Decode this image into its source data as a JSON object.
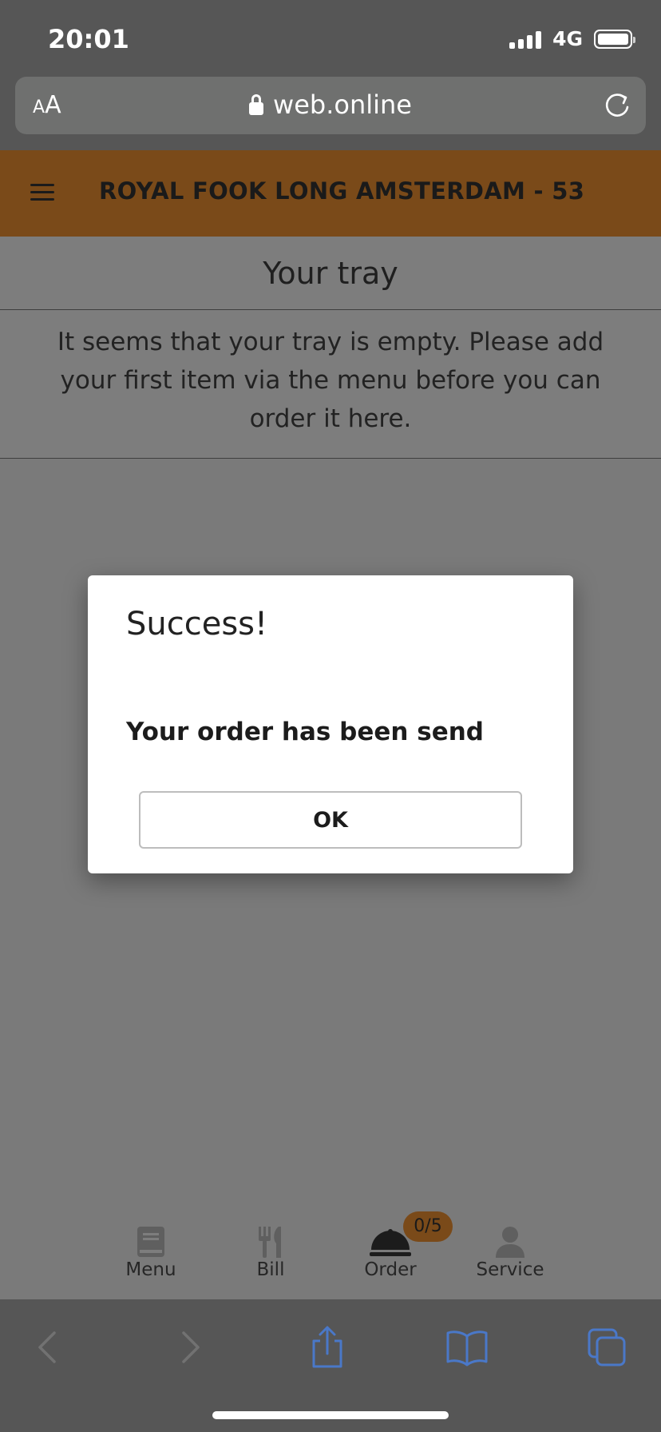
{
  "status": {
    "time": "20:01",
    "network": "4G"
  },
  "browser": {
    "text_size_label_small": "A",
    "text_size_label_large": "A",
    "url": "web.online"
  },
  "header": {
    "restaurant_name": "ROYAL FOOK LONG AMSTERDAM - 53"
  },
  "tray": {
    "title": "Your tray",
    "empty_message": "It seems that your tray is empty. Please add your first item via the menu before you can order it here."
  },
  "dialog": {
    "title": "Success!",
    "message": "Your order has been send",
    "ok_label": "OK"
  },
  "tabs": [
    {
      "label": "Menu",
      "icon": "book-icon"
    },
    {
      "label": "Bill",
      "icon": "cutlery-icon"
    },
    {
      "label": "Order",
      "icon": "service-bell-icon",
      "badge": "0/5"
    },
    {
      "label": "Service",
      "icon": "person-icon"
    }
  ],
  "colors": {
    "brand": "#7a4a19",
    "overlay_background": "#7a7a7a",
    "safari_accent": "#4a78c8"
  }
}
